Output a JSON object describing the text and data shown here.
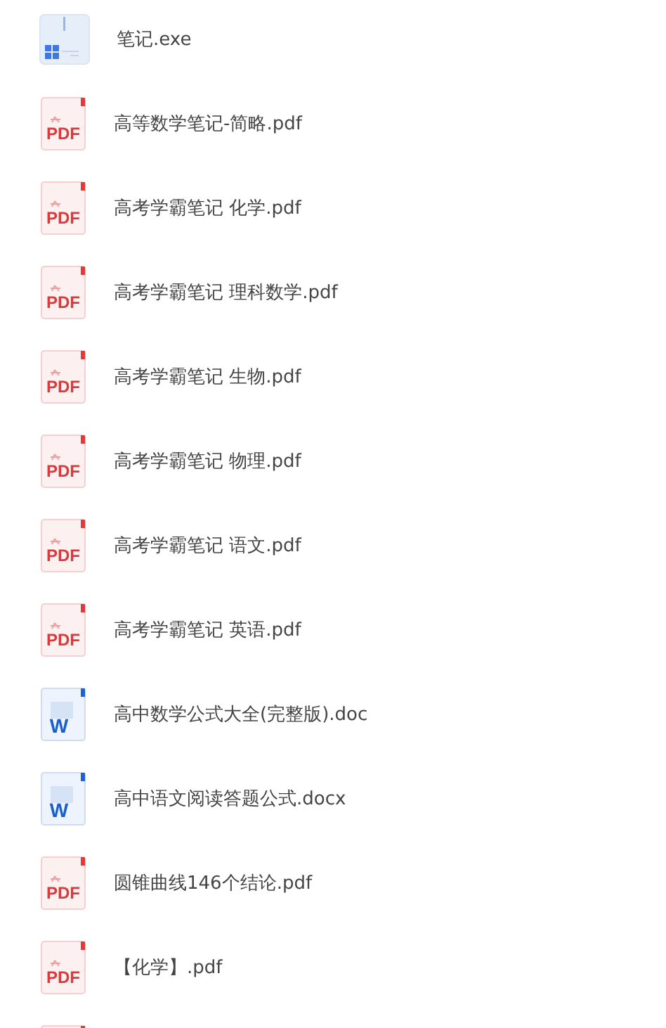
{
  "files": [
    {
      "kind": "exe",
      "name": "笔记.exe"
    },
    {
      "kind": "pdf",
      "icon_label": "PDF",
      "name": "高等数学笔记-简略.pdf"
    },
    {
      "kind": "pdf",
      "icon_label": "PDF",
      "name": "高考学霸笔记 化学.pdf"
    },
    {
      "kind": "pdf",
      "icon_label": "PDF",
      "name": "高考学霸笔记 理科数学.pdf"
    },
    {
      "kind": "pdf",
      "icon_label": "PDF",
      "name": "高考学霸笔记 生物.pdf"
    },
    {
      "kind": "pdf",
      "icon_label": "PDF",
      "name": "高考学霸笔记 物理.pdf"
    },
    {
      "kind": "pdf",
      "icon_label": "PDF",
      "name": "高考学霸笔记 语文.pdf"
    },
    {
      "kind": "pdf",
      "icon_label": "PDF",
      "name": "高考学霸笔记 英语.pdf"
    },
    {
      "kind": "word",
      "icon_label": "W",
      "name": "高中数学公式大全(完整版).doc"
    },
    {
      "kind": "word",
      "icon_label": "W",
      "name": "高中语文阅读答题公式.docx"
    },
    {
      "kind": "pdf",
      "icon_label": "PDF",
      "name": "圆锥曲线146个结论.pdf"
    },
    {
      "kind": "pdf",
      "icon_label": "PDF",
      "name": "【化学】.pdf"
    },
    {
      "kind": "pdf"
    }
  ]
}
